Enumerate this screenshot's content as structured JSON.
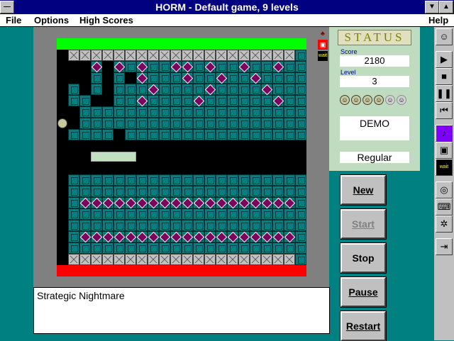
{
  "window": {
    "title": "HORM - Default game, 9 levels",
    "minimize_glyph": "▼",
    "maximize_glyph": "▲"
  },
  "menu": {
    "file": "File",
    "options": "Options",
    "high_scores": "High Scores",
    "help": "Help"
  },
  "status": {
    "title": "STATUS",
    "score_label": "Score",
    "score_value": "2180",
    "level_label": "Level",
    "level_value": "3",
    "lives_active": 4,
    "lives_inactive": 2,
    "mode": "DEMO",
    "difficulty": "Regular"
  },
  "buttons": {
    "new": "New",
    "start": "Start",
    "stop": "Stop",
    "pause": "Pause",
    "restart": "Restart"
  },
  "message": "Strategic Nightmare",
  "side_icons": {
    "sound": "♪",
    "wait": "wait"
  }
}
